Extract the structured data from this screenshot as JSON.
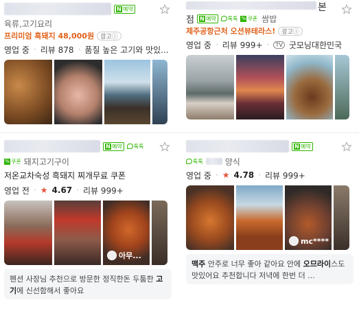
{
  "cards": [
    {
      "name_suffix": "",
      "category": "육류,고기요리",
      "badges": [
        "예약"
      ],
      "promo_text": "프리미엄 흑돼지 48,000원",
      "ad_label": "광고",
      "status": "영업 중",
      "reviews": "리뷰 878",
      "snippet": "품질 높은 고기와 맛있...",
      "photo_count": 4
    },
    {
      "name_suffix": "본",
      "name_prefix_char": "점",
      "category": "쌈밥",
      "badges": [
        "예약",
        "톡톡",
        "쿠폰"
      ],
      "promo_text": "제주공항근처 오션뷰테라스!",
      "ad_label": "광고",
      "status": "영업 중",
      "reviews": "리뷰 999+",
      "tv_label": "TV",
      "tv_show": "굿모닝대한민국",
      "photo_count": 4
    },
    {
      "category": "돼지고기구이",
      "badges": [
        "예약",
        "톡톡",
        "쿠폰"
      ],
      "coupon_line": "저온교차숙성 흑돼지 찌개무료 쿠폰",
      "status": "영업 전",
      "rating": "4.67",
      "reviews": "리뷰 999+",
      "photo_overlay": "아무...",
      "review_text_1": "펜션 사장님 추천으로 방문한 정직한돈 두툼한 ",
      "review_bold": "고기",
      "review_text_2": "에 신선함해서 좋아요"
    },
    {
      "category": "양식",
      "badges": [
        "예약",
        "톡톡"
      ],
      "status": "영업 중",
      "rating": "4.78",
      "reviews": "리뷰 999+",
      "photo_overlay": "mc****",
      "review_bold_a": "맥주",
      "review_text_a": " 안주로 너무 좋아 같아요 안에 ",
      "review_bold_b": "오므라이",
      "review_text_b": "스도 맛있어요 추천합니다 저녁에 한번 더 ..."
    }
  ],
  "badge_labels": {
    "reserve": "예약",
    "talk": "톡톡",
    "coupon": "쿠폰",
    "n": "N"
  },
  "colors": {
    "accent_green": "#2db400",
    "promo_orange": "#e1621c",
    "rating_red": "#e4523b"
  },
  "icons": {
    "bookmark": "star-outline-icon"
  }
}
